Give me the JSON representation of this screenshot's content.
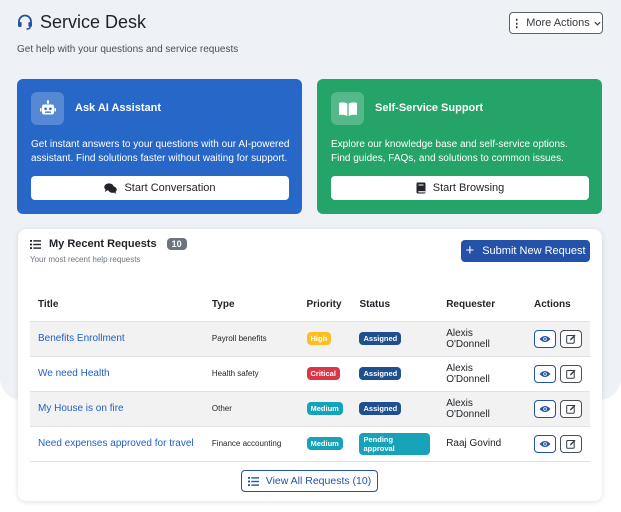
{
  "header": {
    "title": "Service Desk",
    "subtitle": "Get help with your questions and service requests",
    "more_actions": "More Actions"
  },
  "cards": {
    "ai": {
      "title": "Ask AI Assistant",
      "description": "Get instant answers to your questions with our AI-powered assistant. Find solutions faster without waiting for support.",
      "button": "Start Conversation",
      "color": "#2767c7"
    },
    "self_service": {
      "title": "Self-Service Support",
      "description": "Explore our knowledge base and self-service options. Find guides, FAQs, and solutions to common issues.",
      "button": "Start Browsing",
      "color": "#24a469"
    }
  },
  "requests": {
    "title": "My Recent Requests",
    "count": "10",
    "subtitle": "Your most recent help requests",
    "submit_button": "Submit New Request",
    "columns": [
      "Title",
      "Type",
      "Priority",
      "Status",
      "Requester",
      "Actions"
    ],
    "rows": [
      {
        "title": "Benefits Enrollment",
        "type": "Payroll benefits",
        "priority": "High",
        "status": "Assigned",
        "requester": "Alexis O'Donnell"
      },
      {
        "title": "We need Health",
        "type": "Health safety",
        "priority": "Critical",
        "status": "Assigned",
        "requester": "Alexis O'Donnell"
      },
      {
        "title": "My House is on fire",
        "type": "Other",
        "priority": "Medium",
        "status": "Assigned",
        "requester": "Alexis O'Donnell"
      },
      {
        "title": "Need expenses approved for travel",
        "type": "Finance accounting",
        "priority": "Medium",
        "status": "Pending approval",
        "requester": "Raaj Govind"
      }
    ],
    "view_all": "View All Requests (10)"
  },
  "colors": {
    "primary": "#2452a8",
    "high": "#fbbf24",
    "critical": "#dc3545",
    "medium": "#16a2b8",
    "assigned": "#1f4f8c",
    "pending": "#17a2b8"
  }
}
